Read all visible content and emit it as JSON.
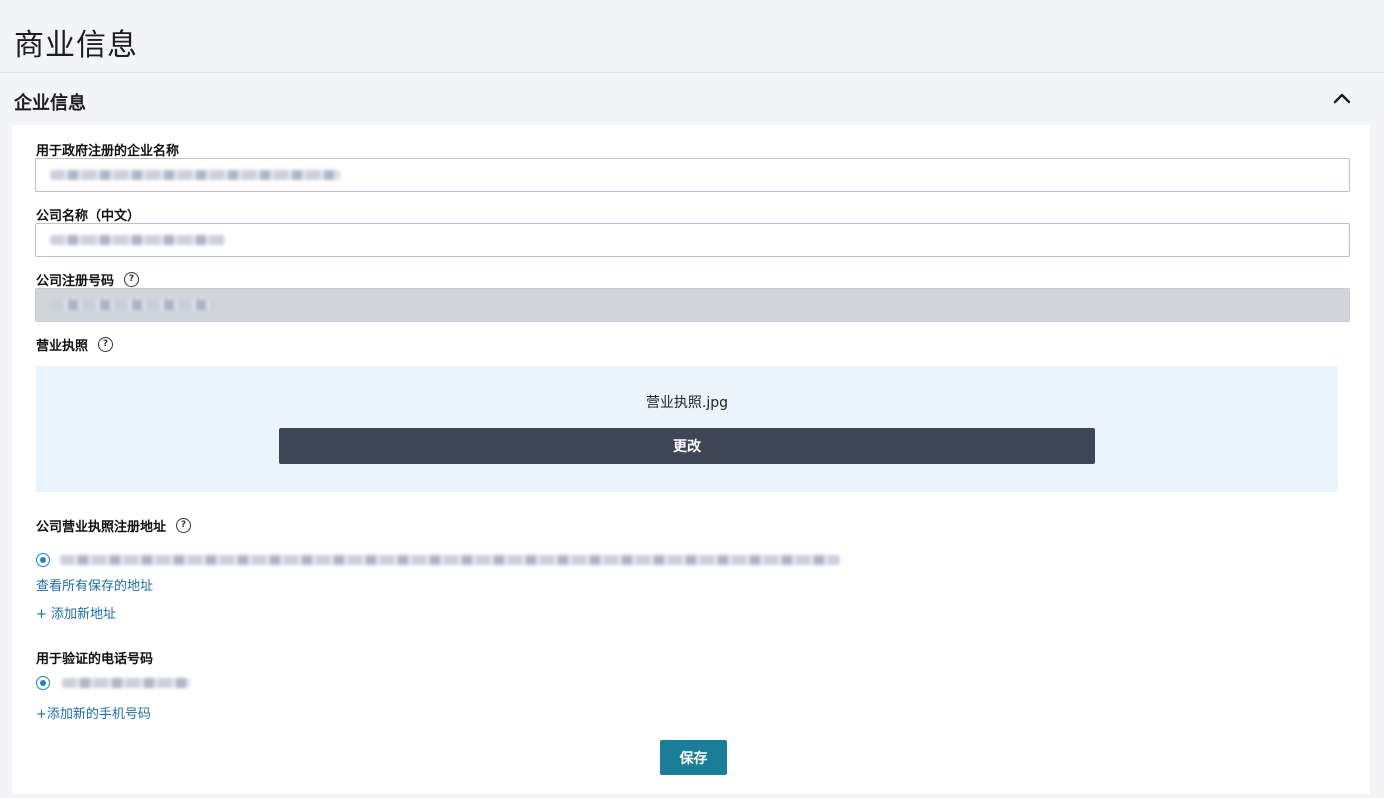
{
  "page": {
    "title": "商业信息"
  },
  "section": {
    "title": "企业信息",
    "expanded": true,
    "toggle_icon": "chevron-up-icon"
  },
  "fields": {
    "gov_name": {
      "label": "用于政府注册的企业名称",
      "value": ""
    },
    "cn_name": {
      "label": "公司名称（中文）",
      "value": ""
    },
    "reg_number": {
      "label": "公司注册号码",
      "value": "",
      "disabled": true,
      "help_icon": "help-circle-icon"
    },
    "license": {
      "label": "营业执照",
      "help_icon": "help-circle-icon",
      "file_name": "营业执照.jpg",
      "change_label": "更改"
    },
    "address": {
      "label": "公司营业执照注册地址",
      "help_icon": "help-circle-icon",
      "view_all_link": "查看所有保存的地址",
      "add_link": "+ 添加新地址"
    },
    "phone": {
      "label": "用于验证的电话号码",
      "add_link": "+添加新的手机号码"
    }
  },
  "actions": {
    "save_label": "保存"
  },
  "colors": {
    "change_button": "#3e4656",
    "save_button": "#1a7e99",
    "link": "#1e6da8",
    "radio": "#1b83c6",
    "upload_bg": "#eaf4fd"
  }
}
